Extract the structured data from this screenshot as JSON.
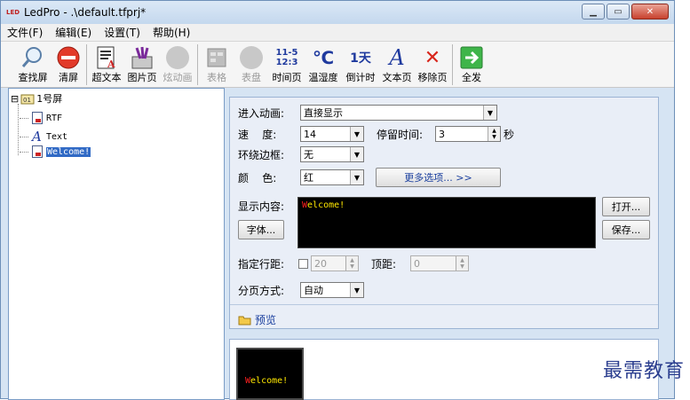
{
  "window": {
    "title": "LedPro - .\\default.tfprj*",
    "app_icon_text": "LED"
  },
  "menu": [
    "文件(F)",
    "编辑(E)",
    "设置(T)",
    "帮助(H)"
  ],
  "toolbar": [
    {
      "label": "查找屏",
      "icon": "search-icon",
      "enabled": true
    },
    {
      "label": "清屏",
      "icon": "no-entry-icon",
      "enabled": true
    },
    {
      "label": "超文本",
      "icon": "richtext-icon",
      "enabled": true
    },
    {
      "label": "图片页",
      "icon": "image-page-icon",
      "enabled": true
    },
    {
      "label": "炫动画",
      "icon": "animation-icon",
      "enabled": false
    },
    {
      "label": "表格",
      "icon": "table-icon",
      "enabled": false
    },
    {
      "label": "表盘",
      "icon": "clock-dial-icon",
      "enabled": false
    },
    {
      "label": "时间页",
      "icon": "time-page-icon",
      "enabled": true,
      "glyph_top": "11-5",
      "glyph_bottom": "12:3"
    },
    {
      "label": "温湿度",
      "icon": "temperature-icon",
      "enabled": true,
      "glyph": "℃"
    },
    {
      "label": "倒计时",
      "icon": "countdown-icon",
      "enabled": true,
      "glyph": "1天"
    },
    {
      "label": "文本页",
      "icon": "text-page-icon",
      "enabled": true,
      "glyph": "A"
    },
    {
      "label": "移除页",
      "icon": "remove-icon",
      "enabled": true,
      "glyph": "✕"
    },
    {
      "label": "全发",
      "icon": "send-all-icon",
      "enabled": true
    }
  ],
  "tree": {
    "root_label": "1号屏",
    "expander": "⊟",
    "children": [
      {
        "label": "RTF"
      },
      {
        "label": "Text"
      },
      {
        "label": "Welcome!"
      }
    ]
  },
  "form": {
    "enter_anim_label": "进入动画:",
    "enter_anim_value": "直接显示",
    "speed_label": "速    度:",
    "speed_value": "14",
    "stay_label": "停留时间:",
    "stay_value": "3",
    "stay_unit": "秒",
    "border_label": "环绕边框:",
    "border_value": "无",
    "color_label": "颜    色:",
    "color_value": "红",
    "more_options": "更多选项... >>",
    "content_label": "显示内容:",
    "content_text_first": "W",
    "content_text_rest": "elcome!",
    "font_button": "字体...",
    "open_button": "打开...",
    "save_button": "保存...",
    "line_spacing_label": "指定行距:",
    "line_spacing_value": "20",
    "top_margin_label": "顶距:",
    "top_margin_value": "0",
    "paging_label": "分页方式:",
    "paging_value": "自动",
    "preview_label": "预览"
  },
  "preview": {
    "text_first": "W",
    "text_rest": "elcome!"
  },
  "watermark": "最需教育",
  "colors": {
    "led_red": "#ff2020",
    "led_yellow": "#ffe800",
    "send_green": "#3fb54a"
  }
}
